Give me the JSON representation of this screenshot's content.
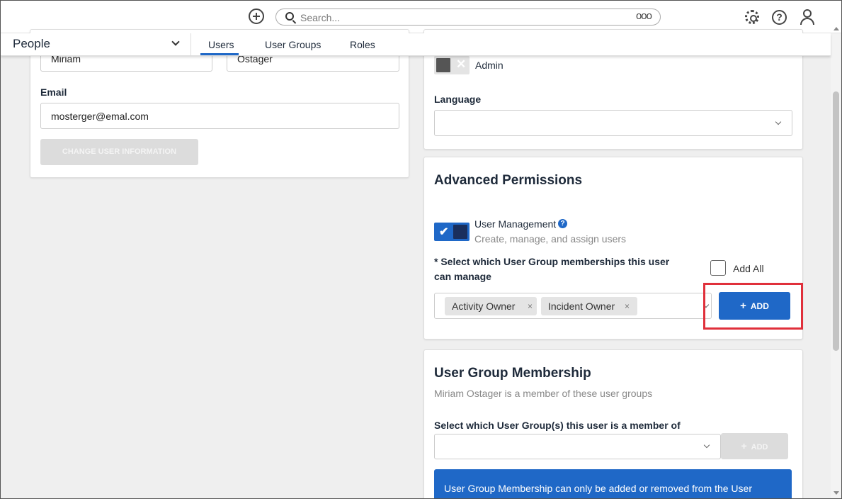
{
  "topbar": {
    "search_placeholder": "Search...",
    "search_more": "ooo"
  },
  "nav": {
    "title": "People",
    "tabs": [
      "Users",
      "User Groups",
      "Roles"
    ],
    "active_tab": "Users"
  },
  "user_info": {
    "first_name": "Miriam",
    "last_name": "Ostager",
    "email_label": "Email",
    "email": "mosterger@emal.com",
    "change_button": "CHANGE USER INFORMATION"
  },
  "settings": {
    "admin_label": "Admin",
    "admin_enabled": false,
    "language_label": "Language",
    "language_value": ""
  },
  "advanced_permissions": {
    "title": "Advanced Permissions",
    "user_management_label": "User Management",
    "user_management_help": "?",
    "user_management_desc": "Create, manage, and assign users",
    "user_management_enabled": true,
    "select_label": "* Select which User Group memberships this user can manage",
    "add_all_label": "Add All",
    "selected_groups": [
      "Activity Owner",
      "Incident Owner"
    ],
    "chip_remove": "×",
    "add_button": "ADD"
  },
  "membership": {
    "title": "User Group Membership",
    "subtitle": "Miriam Ostager is a member of these user groups",
    "select_label": "Select which User Group(s) this user is a member of",
    "add_button": "ADD",
    "banner": "User Group Membership can only be added or removed from the User"
  },
  "colors": {
    "primary": "#1f68c7",
    "toggle_on_dark": "#1a2f5c",
    "highlight": "#e0303b"
  }
}
